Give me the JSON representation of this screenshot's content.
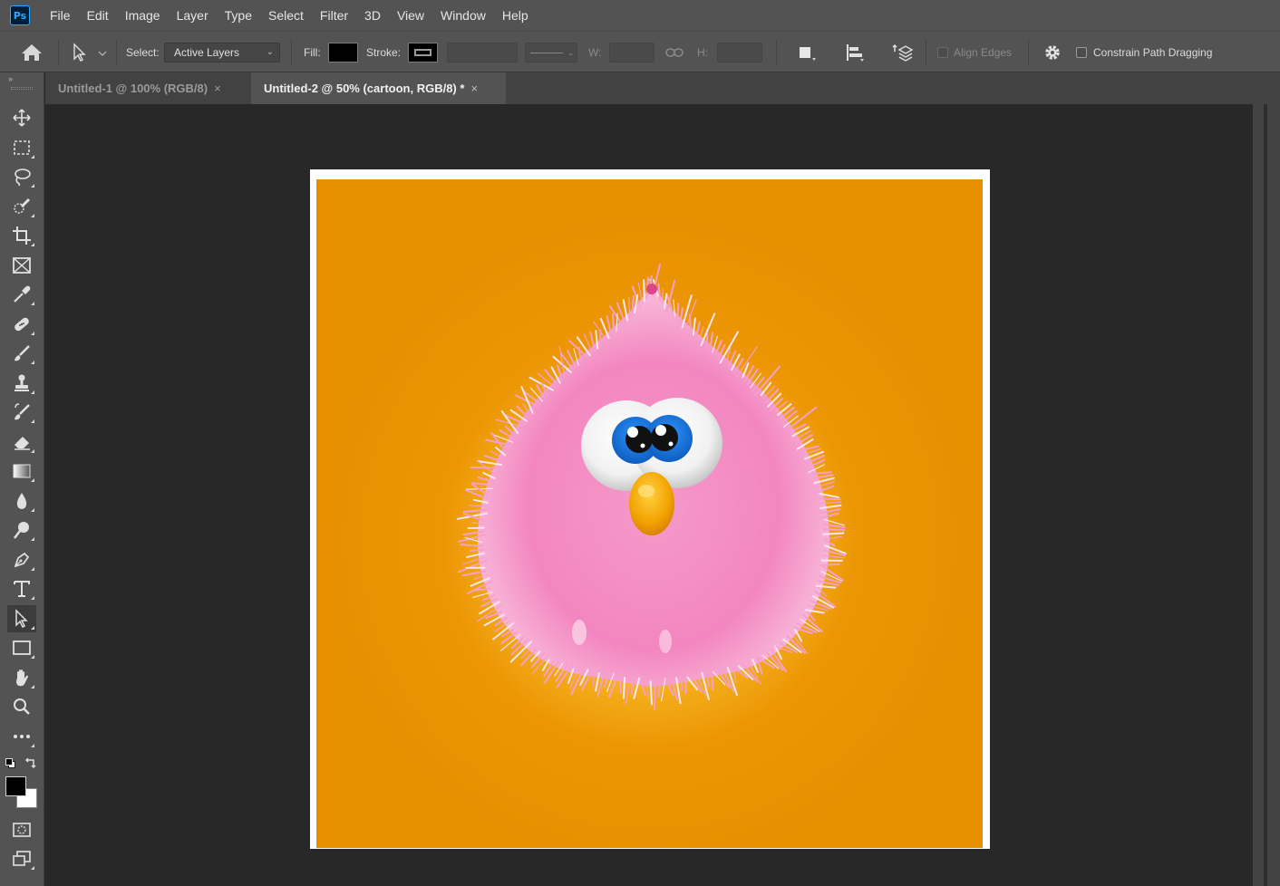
{
  "app": {
    "name": "Ps",
    "logo_text": "Ps"
  },
  "menu": [
    "File",
    "Edit",
    "Image",
    "Layer",
    "Type",
    "Select",
    "Filter",
    "3D",
    "View",
    "Window",
    "Help"
  ],
  "options": {
    "select_label": "Select:",
    "select_value": "Active Layers",
    "fill_label": "Fill:",
    "stroke_label": "Stroke:",
    "w_label": "W:",
    "h_label": "H:",
    "align_edges_label": "Align Edges",
    "constrain_label": "Constrain Path Dragging",
    "fill_color": "#000000",
    "stroke_color": "#000000"
  },
  "tabs": [
    {
      "label": "Untitled-1 @ 100% (RGB/8)",
      "close": "×",
      "active": false
    },
    {
      "label": "Untitled-2 @ 50% (cartoon, RGB/8) *",
      "close": "×",
      "active": true
    }
  ],
  "tools": [
    "move-tool-icon",
    "rectangular-marquee-icon",
    "lasso-icon",
    "quick-selection-icon",
    "crop-icon",
    "frame-icon",
    "eyedropper-icon",
    "healing-brush-icon",
    "brush-icon",
    "clone-stamp-icon",
    "history-brush-icon",
    "eraser-icon",
    "gradient-icon",
    "blur-icon",
    "dodge-icon",
    "pen-icon",
    "type-icon",
    "path-selection-icon",
    "rectangle-icon",
    "hand-icon",
    "zoom-icon",
    "more-tools-icon"
  ],
  "colors": {
    "foreground": "#000000",
    "background": "#ffffff",
    "canvas_orange": "#e88f00",
    "creature_pink": "#f48ac4",
    "iris_blue": "#1573d6",
    "beak_orange": "#f0a000"
  }
}
